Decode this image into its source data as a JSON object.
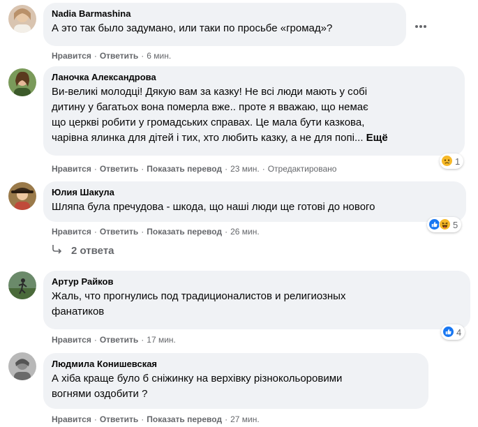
{
  "comments": [
    {
      "author": "Nadia Barmashina",
      "lines": [
        "А это так было задумано, или таки по просьбе «громад»?"
      ],
      "like": "Нравится",
      "reply": "Ответить",
      "time": "6 мин."
    },
    {
      "author": "Ланочка Александрова",
      "lines": [
        "Ви-великі молодці! Дякую вам за казку! Не всі люди мають у собі",
        "дитину у багатьох вона померла вже.. проте я вважаю, що немає",
        "що церкві робити у громадських справах. Це мала бути казкова,",
        "чарівна ялинка для дітей і тих, хто любить казку, а не для попі..."
      ],
      "more": "Ещё",
      "like": "Нравится",
      "reply": "Ответить",
      "translate": "Показать перевод",
      "time": "23 мин.",
      "edited": "Отредактировано",
      "reactions": {
        "icons": [
          "sad-icon"
        ],
        "count": "1"
      }
    },
    {
      "author": "Юлия Шакула",
      "lines": [
        "Шляпа була пречудова - шкода, що наші люди ще готові до нового"
      ],
      "like": "Нравится",
      "reply": "Ответить",
      "translate": "Показать перевод",
      "time": "26 мин.",
      "reactions": {
        "icons": [
          "like-icon",
          "haha-icon"
        ],
        "count": "5"
      }
    },
    {
      "author": "Артур Райков",
      "lines": [
        "Жаль, что прогнулись под традиционалистов и религиозных",
        "фанатиков"
      ],
      "like": "Нравится",
      "reply": "Ответить",
      "time": "17 мин.",
      "reactions": {
        "icons": [
          "like-icon"
        ],
        "count": "4"
      }
    },
    {
      "author": "Людмила Конишевская",
      "lines": [
        "А хіба краще було б сніжинку на верхівку різнокольоровими",
        "вогнями оздобити ?"
      ],
      "like": "Нравится",
      "reply": "Ответить",
      "translate": "Показать перевод",
      "time": "27 мин."
    }
  ],
  "replies_link": "2 ответа",
  "menu_icon": "more-horizontal-icon",
  "colors": {
    "bubble": "#f0f2f5",
    "meta": "#65676b",
    "like_blue": "#1877f2",
    "emoji_yellow": "#f7b928"
  }
}
